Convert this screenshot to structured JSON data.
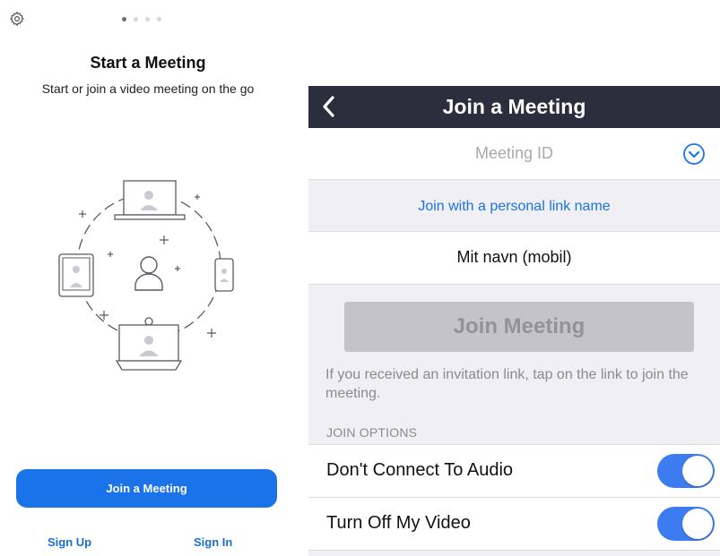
{
  "intro": {
    "page_indicator": {
      "count": 4,
      "active": 1
    },
    "title": "Start a Meeting",
    "subtitle": "Start or join a video meeting on the go",
    "join_button": "Join a Meeting",
    "sign_up": "Sign Up",
    "sign_in": "Sign In",
    "icons": {
      "settings": "gear-icon",
      "illustration": "devices-circle-illustration"
    }
  },
  "join_screen": {
    "nav_title": "Join a Meeting",
    "back_icon": "chevron-left-icon",
    "meeting_id_placeholder": "Meeting ID",
    "dropdown_icon": "chevron-down-circle-icon",
    "personal_link": "Join with a personal link name",
    "name_value": "Mit navn (mobil)",
    "join_button": "Join Meeting",
    "hint": "If you received an invitation link, tap on the link to join the meeting.",
    "options_header": "JOIN OPTIONS",
    "options": [
      {
        "label": "Don't Connect To Audio",
        "on": true
      },
      {
        "label": "Turn Off My Video",
        "on": true
      }
    ]
  },
  "colors": {
    "accent": "#1a73e8",
    "navbar": "#2d2e3d",
    "toggle_on": "#3d7cf0",
    "disabled_button": "#c4c4c8"
  }
}
